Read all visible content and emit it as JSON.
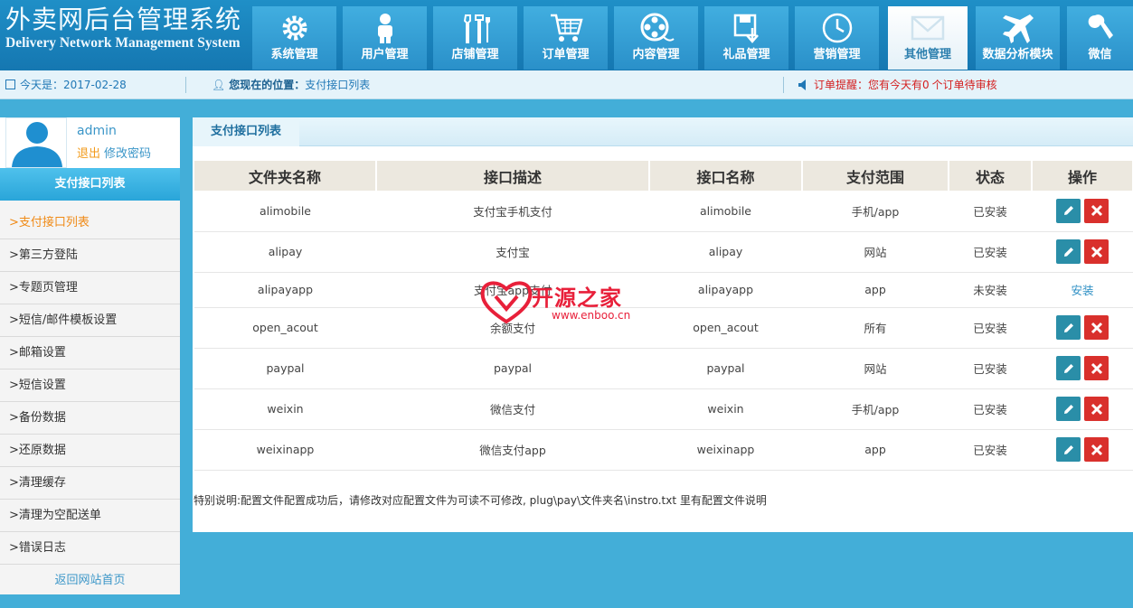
{
  "app": {
    "title_cn": "外卖网后台管理系统",
    "title_en": "Delivery Network Management System"
  },
  "nav": [
    {
      "label": "系统管理",
      "icon": "gear-icon"
    },
    {
      "label": "用户管理",
      "icon": "user-icon"
    },
    {
      "label": "店铺管理",
      "icon": "tools-icon"
    },
    {
      "label": "订单管理",
      "icon": "cart-icon"
    },
    {
      "label": "内容管理",
      "icon": "film-reel-icon"
    },
    {
      "label": "礼品管理",
      "icon": "save-box-icon"
    },
    {
      "label": "营销管理",
      "icon": "clock-icon"
    },
    {
      "label": "其他管理",
      "icon": "envelope-icon",
      "active": true
    },
    {
      "label": "数据分析模块",
      "icon": "airplane-icon"
    },
    {
      "label": "微信",
      "icon": "wrench-icon"
    }
  ],
  "infobar": {
    "date_label": "今天是：",
    "date_value": "2017-02-28",
    "location_label": "您现在的位置：",
    "location_value": "支付接口列表",
    "order_label": "订单提醒：",
    "order_prefix": "您有今天有",
    "order_count": "0",
    "order_suffix": "个订单待审核"
  },
  "user": {
    "name": "admin",
    "logout": "退出",
    "change_password": "修改密码"
  },
  "sidebar": {
    "title": "支付接口列表",
    "items": [
      {
        "label": ">支付接口列表",
        "active": true
      },
      {
        "label": ">第三方登陆"
      },
      {
        "label": ">专题页管理"
      },
      {
        "label": ">短信/邮件模板设置"
      },
      {
        "label": ">邮箱设置"
      },
      {
        "label": ">短信设置"
      },
      {
        "label": ">备份数据"
      },
      {
        "label": ">还原数据"
      },
      {
        "label": ">清理缓存"
      },
      {
        "label": ">清理为空配送单"
      },
      {
        "label": ">错误日志"
      }
    ],
    "back_home": "返回网站首页"
  },
  "panel": {
    "title": "支付接口列表",
    "columns": [
      "文件夹名称",
      "接口描述",
      "接口名称",
      "支付范围",
      "状态",
      "操作"
    ],
    "rows": [
      {
        "folder": "alimobile",
        "desc": "支付宝手机支付",
        "name": "alimobile",
        "scope": "手机/app",
        "status": "已安装",
        "installed": true
      },
      {
        "folder": "alipay",
        "desc": "支付宝",
        "name": "alipay",
        "scope": "网站",
        "status": "已安装",
        "installed": true
      },
      {
        "folder": "alipayapp",
        "desc": "支付宝app支付",
        "name": "alipayapp",
        "scope": "app",
        "status": "未安装",
        "installed": false
      },
      {
        "folder": "open_acout",
        "desc": "余额支付",
        "name": "open_acout",
        "scope": "所有",
        "status": "已安装",
        "installed": true
      },
      {
        "folder": "paypal",
        "desc": "paypal",
        "name": "paypal",
        "scope": "网站",
        "status": "已安装",
        "installed": true
      },
      {
        "folder": "weixin",
        "desc": "微信支付",
        "name": "weixin",
        "scope": "手机/app",
        "status": "已安装",
        "installed": true
      },
      {
        "folder": "weixinapp",
        "desc": "微信支付app",
        "name": "weixinapp",
        "scope": "app",
        "status": "已安装",
        "installed": true
      }
    ],
    "install_label": "安装",
    "note": "特别说明:配置文件配置成功后，请修改对应配置文件为可读不可修改, plug\\pay\\文件夹名\\instro.txt 里有配置文件说明"
  },
  "watermark": {
    "text": "开源之家",
    "url": "www.enboo.cn"
  },
  "colors": {
    "header": "#1a83bd",
    "background": "#43aed8",
    "edit_button": "#2a8ea8",
    "delete_button": "#d9302c",
    "active_menu": "#f08a16",
    "alert_text": "#d42020"
  }
}
